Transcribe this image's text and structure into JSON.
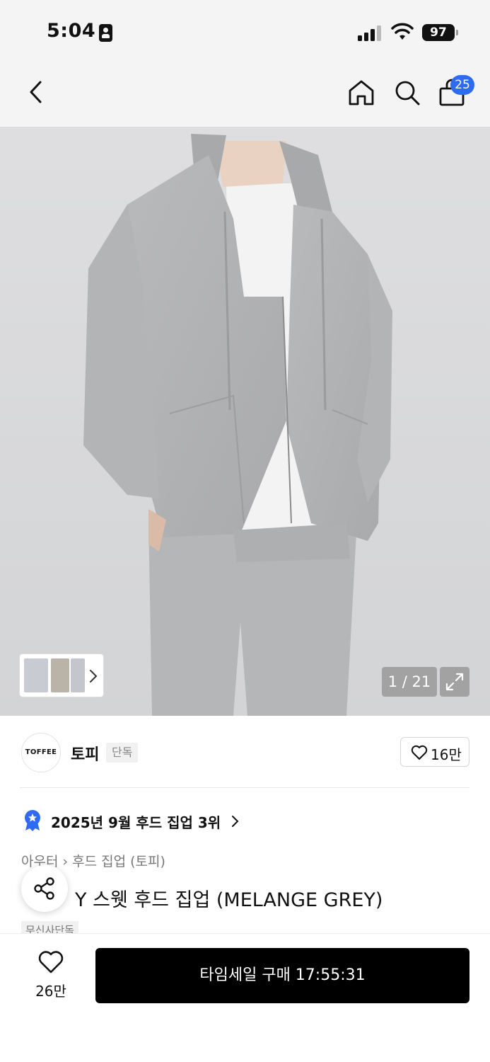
{
  "status_bar": {
    "time": "5:04",
    "battery": "97"
  },
  "nav": {
    "back_icon": "chevron-left-icon",
    "home_icon": "home-icon",
    "search_icon": "search-icon",
    "cart_icon": "shopping-bag-icon",
    "cart_count": "25"
  },
  "gallery": {
    "page_counter": "1 / 21",
    "expand_icon": "expand-icon"
  },
  "brand": {
    "logo_text": "TOFFEE",
    "name": "토피",
    "tag": "단독",
    "like_count": "16만"
  },
  "ranking": {
    "text": "2025년 9월 후드 집업 3위"
  },
  "breadcrumb": "아우터 › 후드 집업 (토피)",
  "product": {
    "title": "Y 스웻 후드 집업 (MELANGE GREY)",
    "badge": "무신사단독"
  },
  "bottom_bar": {
    "wish_count": "26만",
    "buy_label": "타임세일 구매 17:55:31"
  },
  "colors": {
    "accent_blue": "#2f6bf0",
    "buy_button": "#000000",
    "background": "#ffffff"
  }
}
